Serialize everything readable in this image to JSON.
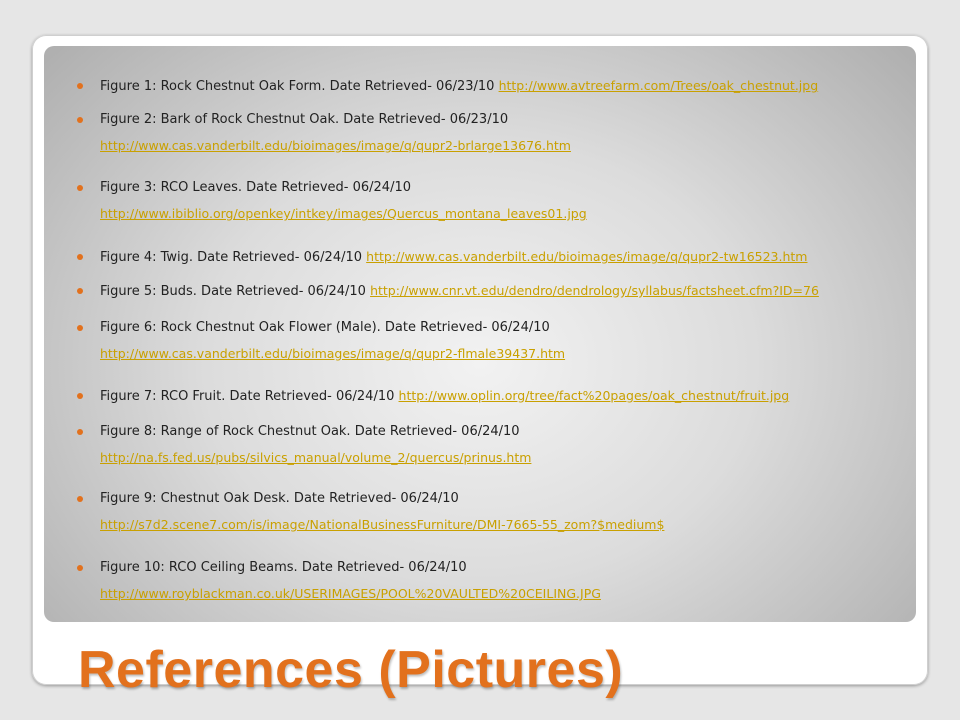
{
  "colors": {
    "bullet": "#e2711d",
    "link": "#c9a000",
    "title": "#e2711d"
  },
  "title": "References (Pictures)",
  "references": [
    {
      "text": "Figure 1: Rock Chestnut Oak Form. Date Retrieved- 06/23/10",
      "url": "http://www.avtreefarm.com/Trees/oak_chestnut.jpg"
    },
    {
      "text": "Figure 2: Bark of Rock Chestnut Oak. Date Retrieved- 06/23/10",
      "url": "http://www.cas.vanderbilt.edu/bioimages/image/q/qupr2-brlarge13676.htm"
    },
    {
      "text": "Figure 3: RCO Leaves. Date Retrieved- 06/24/10",
      "url": "http://www.ibiblio.org/openkey/intkey/images/Quercus_montana_leaves01.jpg"
    },
    {
      "text": "Figure 4: Twig. Date Retrieved- 06/24/10",
      "url": "http://www.cas.vanderbilt.edu/bioimages/image/q/qupr2-tw16523.htm"
    },
    {
      "text": "Figure 5: Buds. Date Retrieved- 06/24/10",
      "url": "http://www.cnr.vt.edu/dendro/dendrology/syllabus/factsheet.cfm?ID=76"
    },
    {
      "text": "Figure 6: Rock Chestnut Oak Flower (Male). Date Retrieved- 06/24/10",
      "url": "http://www.cas.vanderbilt.edu/bioimages/image/q/qupr2-flmale39437.htm"
    },
    {
      "text": "Figure 7: RCO Fruit. Date Retrieved- 06/24/10",
      "url": "http://www.oplin.org/tree/fact%20pages/oak_chestnut/fruit.jpg"
    },
    {
      "text": "Figure 8: Range of Rock Chestnut Oak. Date Retrieved- 06/24/10",
      "url": "http://na.fs.fed.us/pubs/silvics_manual/volume_2/quercus/prinus.htm"
    },
    {
      "text": "Figure 9: Chestnut Oak Desk. Date Retrieved- 06/24/10",
      "url": "http://s7d2.scene7.com/is/image/NationalBusinessFurniture/DMI-7665-55_zom?$medium$"
    },
    {
      "text": "Figure 10: RCO Ceiling Beams. Date Retrieved- 06/24/10",
      "url": "http://www.royblackman.co.uk/USERIMAGES/POOL%20VAULTED%20CEILING.JPG"
    }
  ]
}
